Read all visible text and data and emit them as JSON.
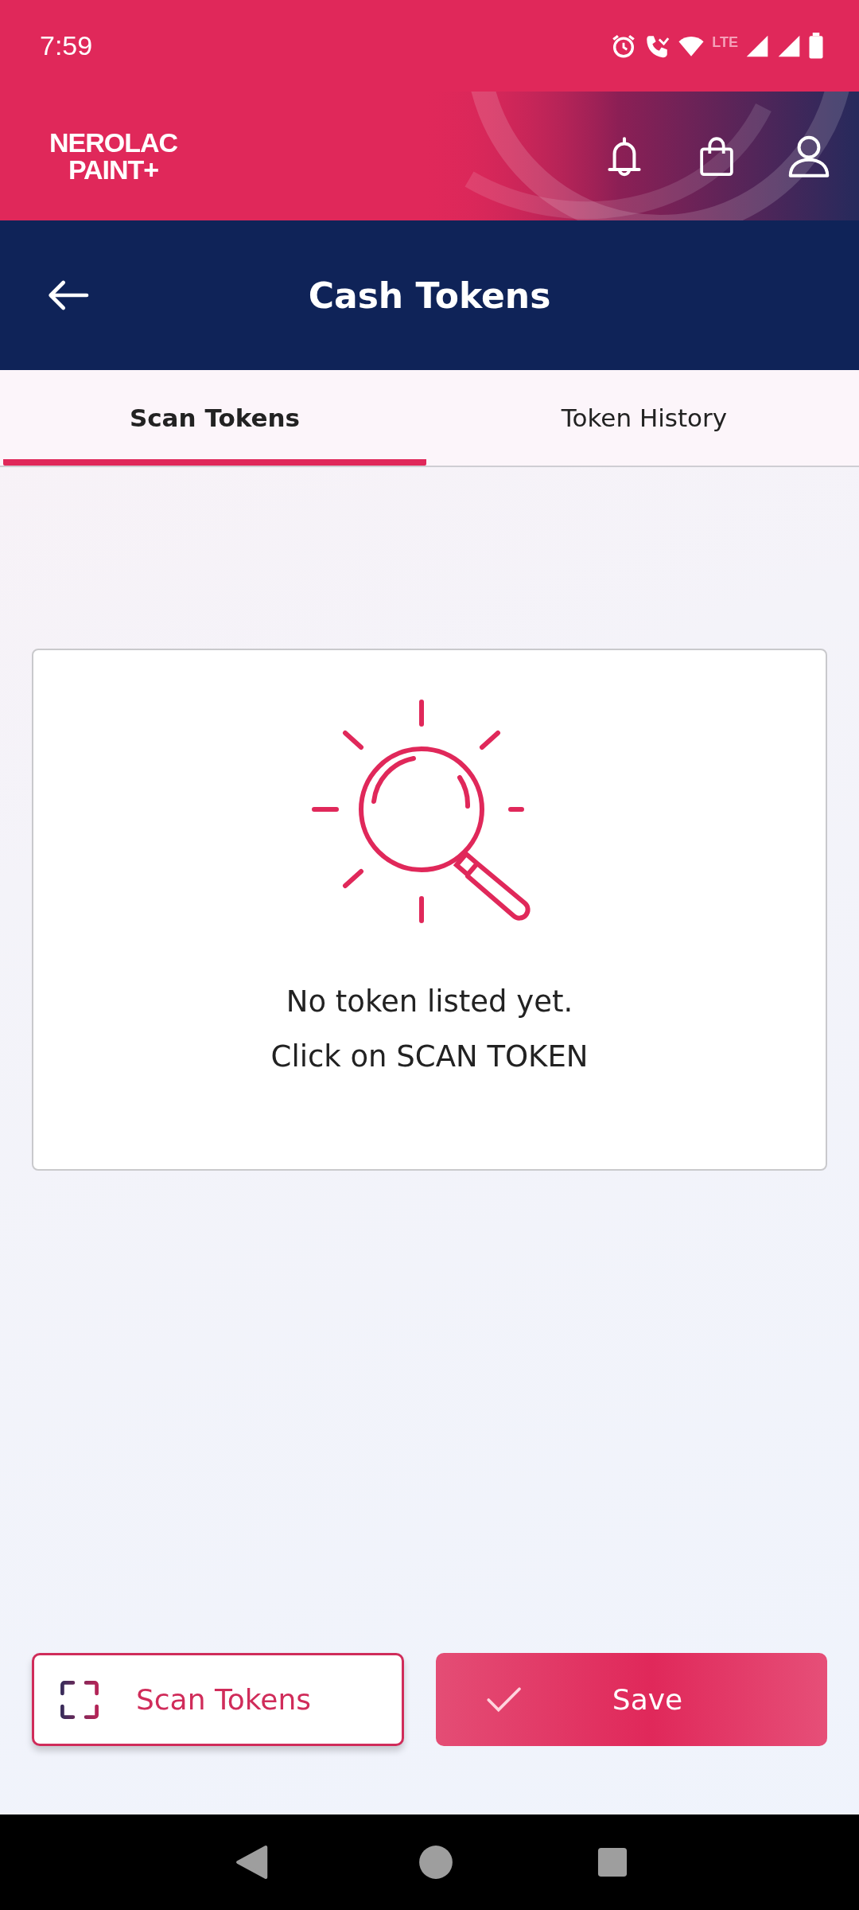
{
  "status_bar": {
    "time": "7:59",
    "network": "LTE"
  },
  "header": {
    "logo": [
      "NEROLAC",
      "PAINT+"
    ]
  },
  "title_bar": {
    "title": "Cash Tokens"
  },
  "tabs": [
    {
      "label": "Scan Tokens",
      "selected": true
    },
    {
      "label": "Token History",
      "selected": false
    }
  ],
  "empty_state": {
    "lines": [
      "No token listed yet.",
      "Click on SCAN TOKEN"
    ]
  },
  "buttons": [
    {
      "kind": "outline",
      "label": "Scan Tokens"
    },
    {
      "kind": "filled",
      "label": "Save"
    }
  ]
}
